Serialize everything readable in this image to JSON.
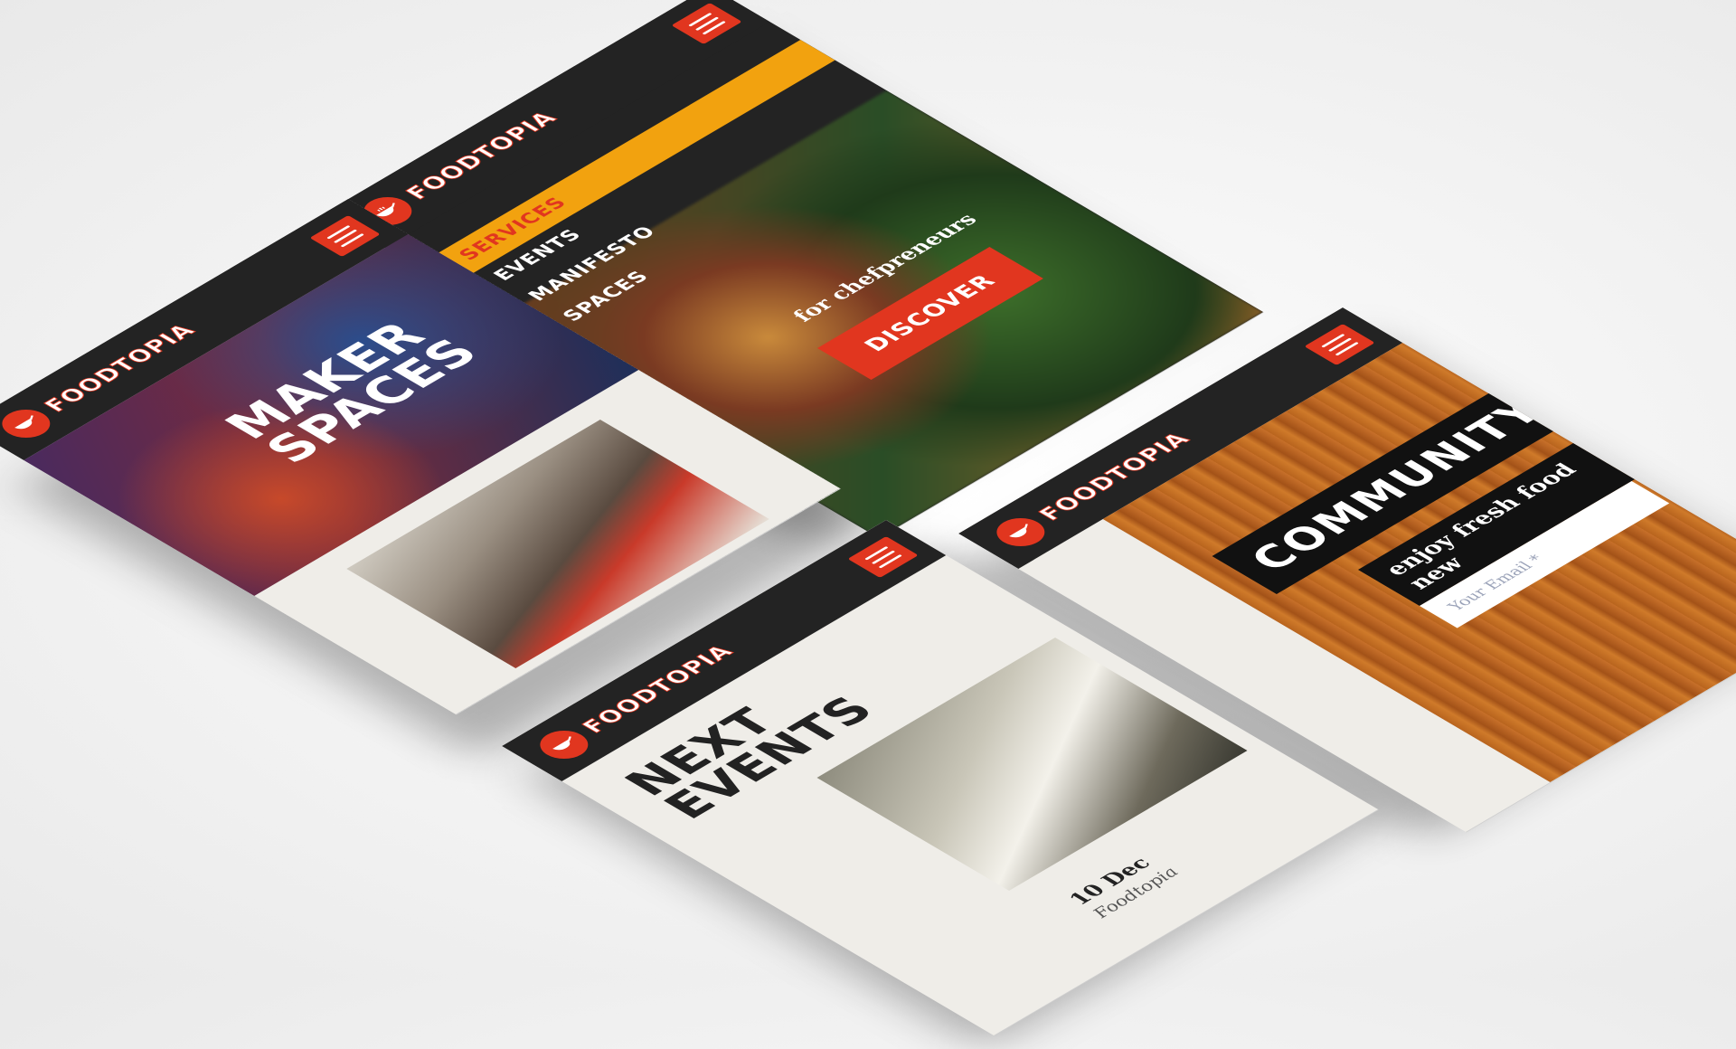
{
  "brand": {
    "name": "FOODTOPIA",
    "accent": "#e1361f",
    "nav_active": "#f2a20f",
    "dark": "#232323"
  },
  "screen_menu": {
    "nav_items": [
      "SERVICES",
      "EVENTS",
      "MANIFESTO",
      "SPACES"
    ],
    "tagline": "for chefpreneurs",
    "cta": "DISCOVER"
  },
  "screen_maker": {
    "title_line1": "MAKER",
    "title_line2": "SPACES"
  },
  "screen_events": {
    "title_line1": "NEXT",
    "title_line2": "EVENTS",
    "event_date": "10 Dec",
    "event_place": "Foodtopia"
  },
  "screen_community": {
    "title": "COMMUNITY",
    "subtitle": "enjoy fresh food new",
    "email_placeholder": "Your Email *"
  },
  "icons": [
    "logo-pan-icon",
    "hamburger-menu-icon"
  ]
}
